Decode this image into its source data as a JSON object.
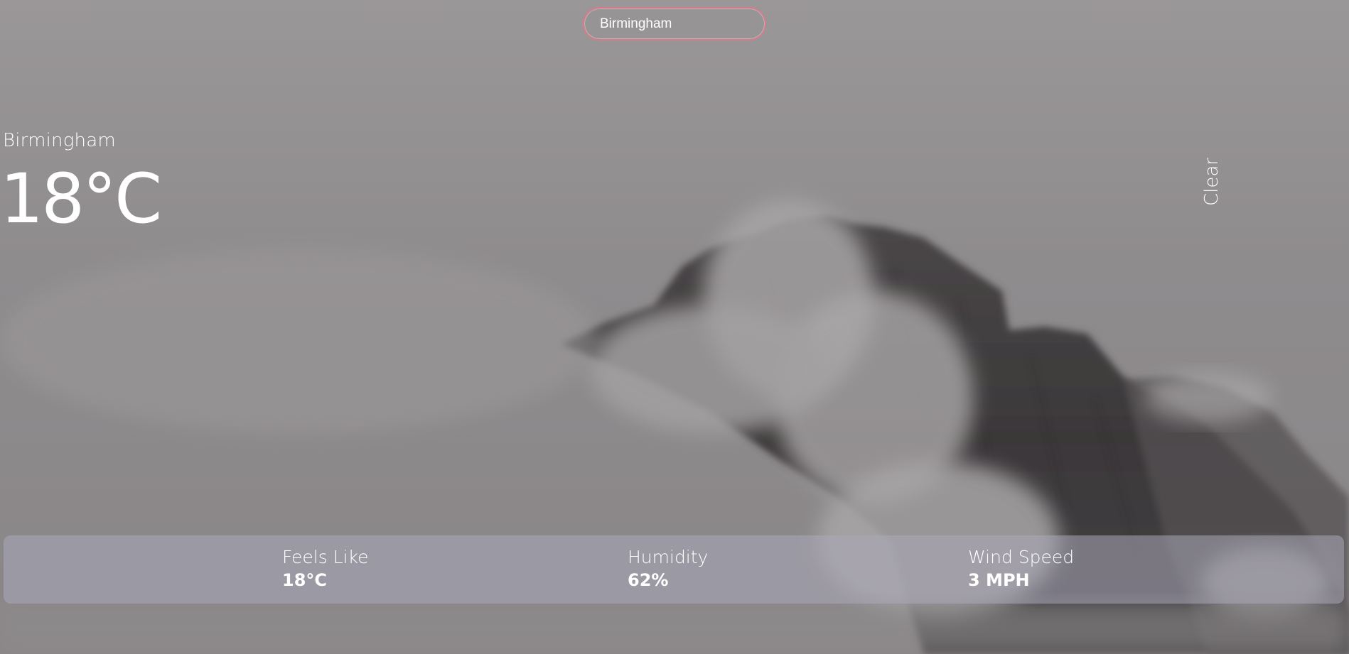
{
  "search": {
    "value": "Birmingham",
    "placeholder": ""
  },
  "location": {
    "city": "Birmingham"
  },
  "current": {
    "temperature": "18°C",
    "condition": "Clear"
  },
  "stats": {
    "feels_like_label": "Feels Like",
    "feels_like_value": "18°C",
    "humidity_label": "Humidity",
    "humidity_value": "62%",
    "wind_label": "Wind Speed",
    "wind_value": "3 MPH"
  },
  "background": {
    "icon": "mountain-in-clouds-image",
    "sky_color": "#9a9798",
    "rock_color": "#3a3738",
    "accent_border": "#d97a8a"
  }
}
